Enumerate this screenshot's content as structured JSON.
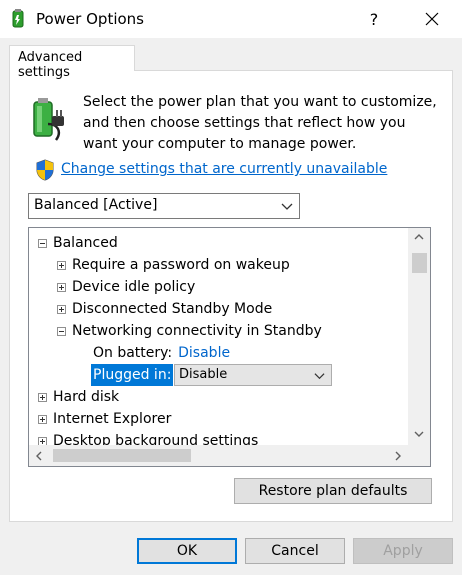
{
  "window": {
    "title": "Power Options",
    "help_label": "?"
  },
  "tab": {
    "label": "Advanced settings"
  },
  "description": "Select the power plan that you want to customize, and then choose settings that reflect how you want your computer to manage power.",
  "change_link": "Change settings that are currently unavailable",
  "plan_select": {
    "value": "Balanced [Active]"
  },
  "tree": {
    "root": "Balanced",
    "items": [
      "Require a password on wakeup",
      "Device idle policy",
      "Disconnected Standby Mode",
      "Networking connectivity in Standby"
    ],
    "on_battery": {
      "label": "On battery:",
      "value": "Disable"
    },
    "plugged_in": {
      "label": "Plugged in:",
      "value": "Disable"
    },
    "others": [
      "Hard disk",
      "Internet Explorer",
      "Desktop background settings"
    ]
  },
  "buttons": {
    "restore": "Restore plan defaults",
    "ok": "OK",
    "cancel": "Cancel",
    "apply": "Apply"
  },
  "colors": {
    "link": "#0066cc",
    "selection": "#0078d7",
    "battery_green": "#2e9e2e"
  },
  "icons": [
    "power-options-icon",
    "battery-plug-icon",
    "uac-shield-icon",
    "close-icon",
    "chevron-down-icon",
    "expand-icon",
    "collapse-icon",
    "scroll-arrow-icon"
  ]
}
